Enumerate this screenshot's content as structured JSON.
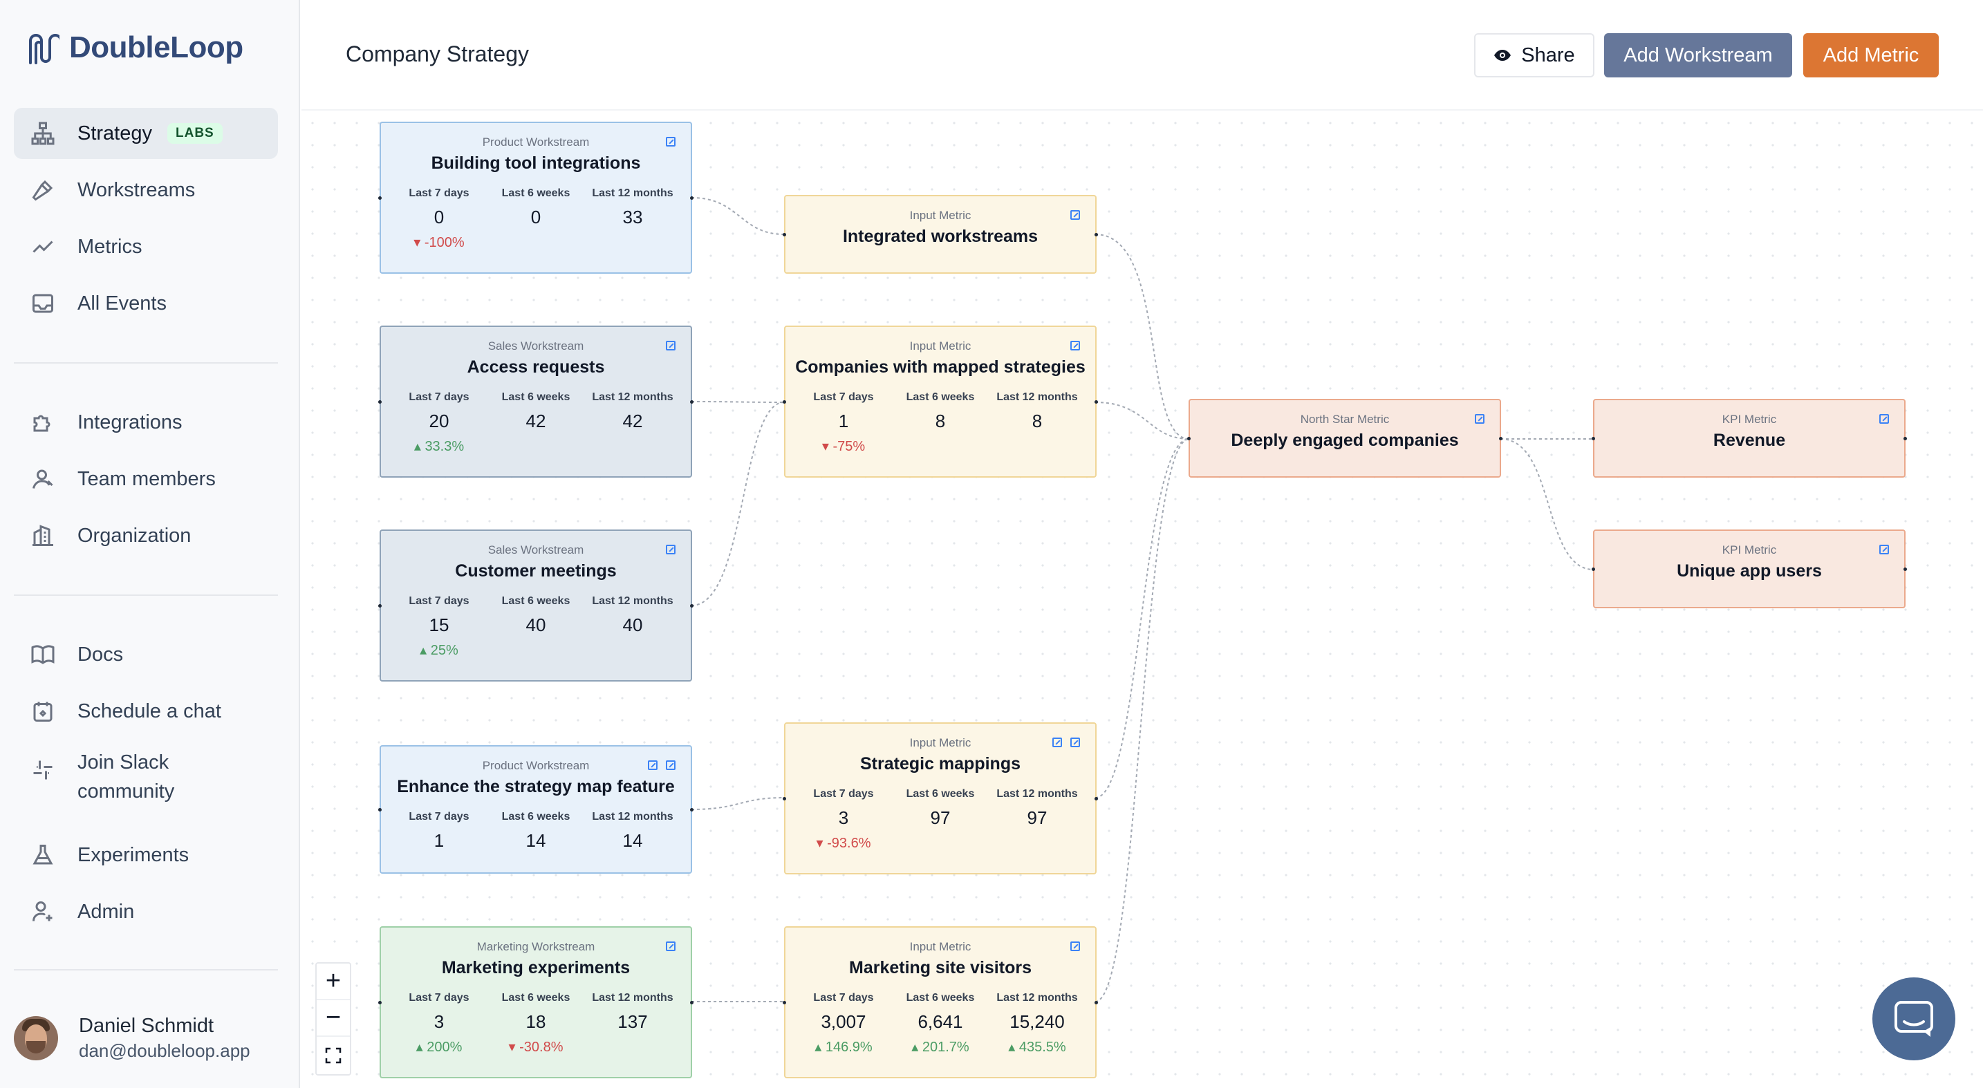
{
  "brand": {
    "name": "DoubleLoop"
  },
  "sidebar": {
    "primary": [
      {
        "label": "Strategy",
        "badge": "LABS",
        "icon": "sitemap-icon"
      },
      {
        "label": "Workstreams",
        "icon": "hammer-icon"
      },
      {
        "label": "Metrics",
        "icon": "trend-line-icon"
      },
      {
        "label": "All Events",
        "icon": "inbox-icon"
      }
    ],
    "secondary": [
      {
        "label": "Integrations",
        "icon": "puzzle-icon"
      },
      {
        "label": "Team members",
        "icon": "users-icon"
      },
      {
        "label": "Organization",
        "icon": "building-icon"
      }
    ],
    "tertiary": [
      {
        "label": "Docs",
        "icon": "book-icon"
      },
      {
        "label": "Schedule a chat",
        "icon": "calendar-icon"
      },
      {
        "label": "Join Slack community",
        "icon": "slack-icon"
      },
      {
        "label": "Experiments",
        "icon": "flask-icon"
      },
      {
        "label": "Admin",
        "icon": "user-gear-icon"
      }
    ],
    "user": {
      "name": "Daniel Schmidt",
      "email": "dan@doubleloop.app"
    }
  },
  "header": {
    "title": "Company Strategy",
    "share_label": "Share",
    "add_workstream_label": "Add Workstream",
    "add_metric_label": "Add Metric"
  },
  "stat_labels": {
    "d7": "Last 7 days",
    "w6": "Last 6 weeks",
    "m12": "Last 12 months"
  },
  "nodes": {
    "building_tool": {
      "type": "Product Workstream",
      "name": "Building tool integrations",
      "d7": "0",
      "w6": "0",
      "m12": "33",
      "chg7": "-100%",
      "chg7_dir": "down"
    },
    "access_requests": {
      "type": "Sales Workstream",
      "name": "Access requests",
      "d7": "20",
      "w6": "42",
      "m12": "42",
      "chg7": "33.3%",
      "chg7_dir": "up"
    },
    "customer_meetings": {
      "type": "Sales Workstream",
      "name": "Customer meetings",
      "d7": "15",
      "w6": "40",
      "m12": "40",
      "chg7": "25%",
      "chg7_dir": "up"
    },
    "enhance_map": {
      "type": "Product Workstream",
      "name": "Enhance the strategy map feature",
      "d7": "1",
      "w6": "14",
      "m12": "14"
    },
    "marketing_experiments": {
      "type": "Marketing Workstream",
      "name": "Marketing experiments",
      "d7": "3",
      "w6": "18",
      "m12": "137",
      "chg7": "200%",
      "chg7_dir": "up",
      "chg6": "-30.8%",
      "chg6_dir": "down"
    },
    "integrated_workstreams": {
      "type": "Input Metric",
      "name": "Integrated workstreams"
    },
    "companies_mapped": {
      "type": "Input Metric",
      "name": "Companies with mapped strategies",
      "d7": "1",
      "w6": "8",
      "m12": "8",
      "chg7": "-75%",
      "chg7_dir": "down"
    },
    "strategic_mappings": {
      "type": "Input Metric",
      "name": "Strategic mappings",
      "d7": "3",
      "w6": "97",
      "m12": "97",
      "chg7": "-93.6%",
      "chg7_dir": "down"
    },
    "site_visitors": {
      "type": "Input Metric",
      "name": "Marketing site visitors",
      "d7": "3,007",
      "w6": "6,641",
      "m12": "15,240",
      "chg7": "146.9%",
      "chg7_dir": "up",
      "chg6": "201.7%",
      "chg6_dir": "up",
      "chg12": "435.5%",
      "chg12_dir": "up"
    },
    "deeply_engaged": {
      "type": "North Star Metric",
      "name": "Deeply engaged companies"
    },
    "revenue": {
      "type": "KPI Metric",
      "name": "Revenue"
    },
    "unique_users": {
      "type": "KPI Metric",
      "name": "Unique app users"
    }
  },
  "zoom": {
    "in": "+",
    "out": "−",
    "fit": "fit-screen-icon"
  },
  "chat": {
    "icon": "chat-bubble-icon"
  },
  "colors": {
    "brand": "#334a78",
    "add_workstream": "#66779a",
    "add_metric": "#dc7633",
    "up": "#4b9c64",
    "down": "#d14b4b"
  }
}
